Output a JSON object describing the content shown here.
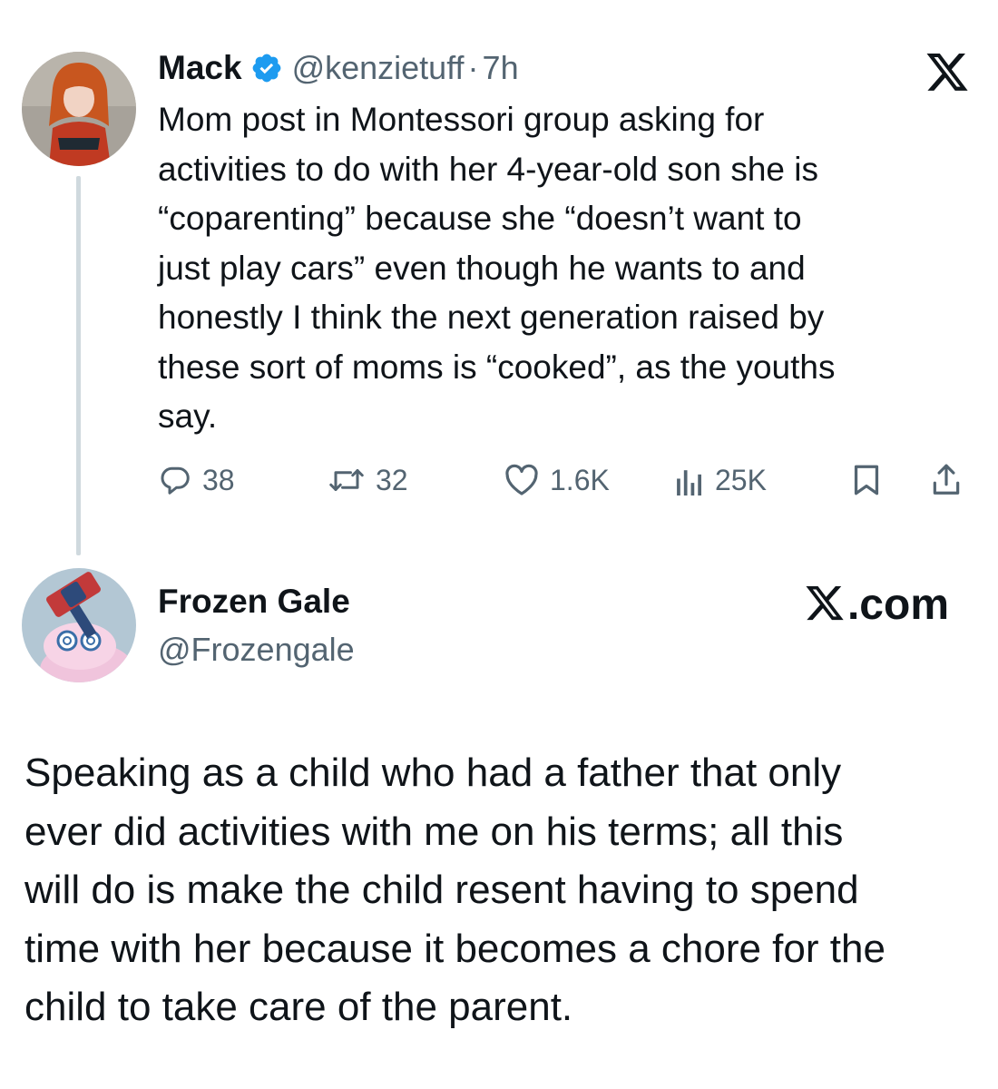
{
  "thread_tweet": {
    "author_name": "Mack",
    "author_handle": "@kenzietuff",
    "separator": "·",
    "time_ago": "7h",
    "verified": true,
    "text": "Mom post in Montessori group asking for\nactivities to do with her 4-year-old son she is\n“coparenting” because she “doesn’t want to\njust play cars” even though he wants to and\nhonestly I think the next generation raised by\nthese sort of moms is “cooked”, as the youths\nsay.",
    "metrics": {
      "replies": "38",
      "reposts": "32",
      "likes": "1.6K",
      "views": "25K"
    }
  },
  "reply_tweet": {
    "author_name": "Frozen Gale",
    "author_handle": "@Frozengale",
    "source_label": ".com",
    "text": "Speaking as a child who had a father that only\never did activities with me on his terms; all this\nwill do is make the child resent having to spend\ntime with her because it becomes a chore for the\nchild to take care of the parent."
  },
  "icons": {
    "verified": "verified-badge-icon",
    "x_logo": "x-logo-icon",
    "reply": "reply-icon",
    "repost": "repost-icon",
    "like": "like-icon",
    "views": "views-icon",
    "bookmark": "bookmark-icon",
    "share": "share-icon"
  },
  "colors": {
    "text_primary": "#0f1419",
    "text_secondary": "#536471",
    "verified_blue": "#1d9bf0",
    "thread_line": "#cfd9de"
  }
}
